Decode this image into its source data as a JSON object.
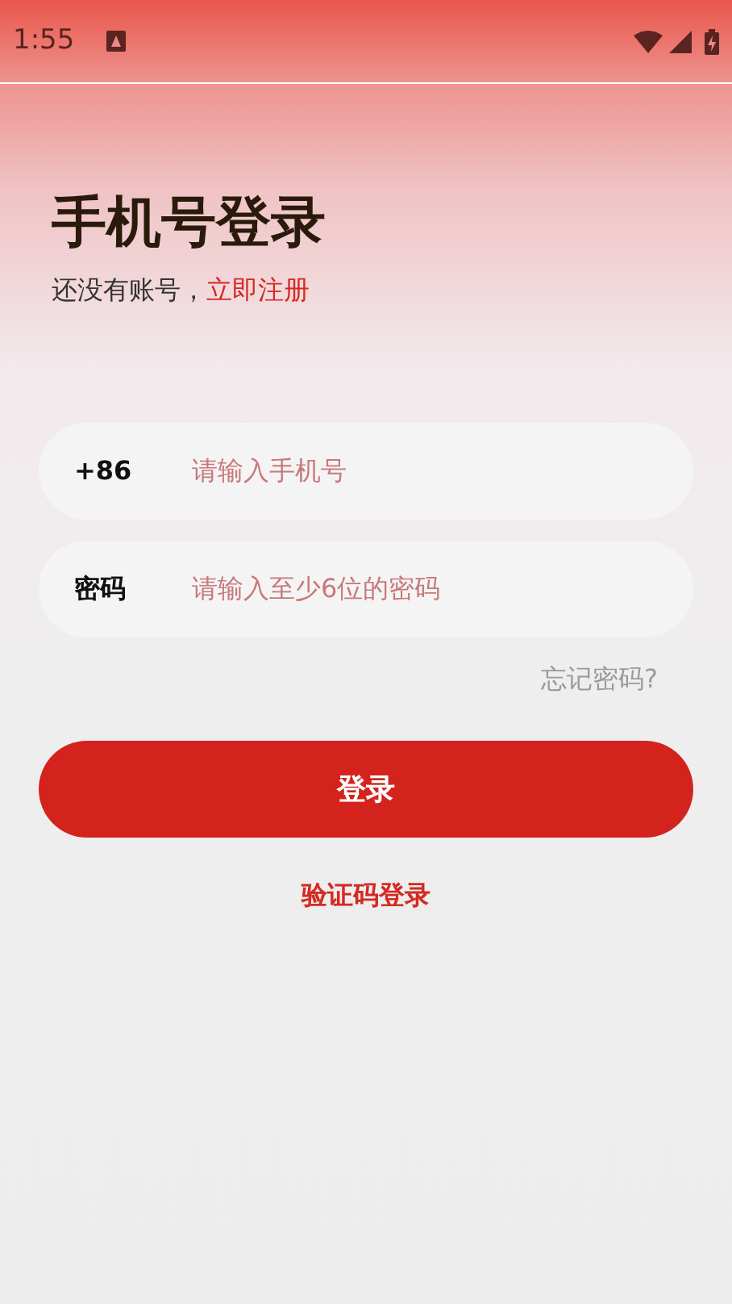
{
  "status_bar": {
    "time": "1:55"
  },
  "title": "手机号登录",
  "subtitle": {
    "text": "还没有账号，",
    "link": "立即注册"
  },
  "fields": [
    {
      "label": "+86",
      "placeholder": "请输入手机号"
    },
    {
      "label": "密码",
      "placeholder": "请输入至少6位的密码"
    }
  ],
  "forgot_link": "忘记密码?",
  "login_button": "登录",
  "sms_login_link": "验证码登录"
}
